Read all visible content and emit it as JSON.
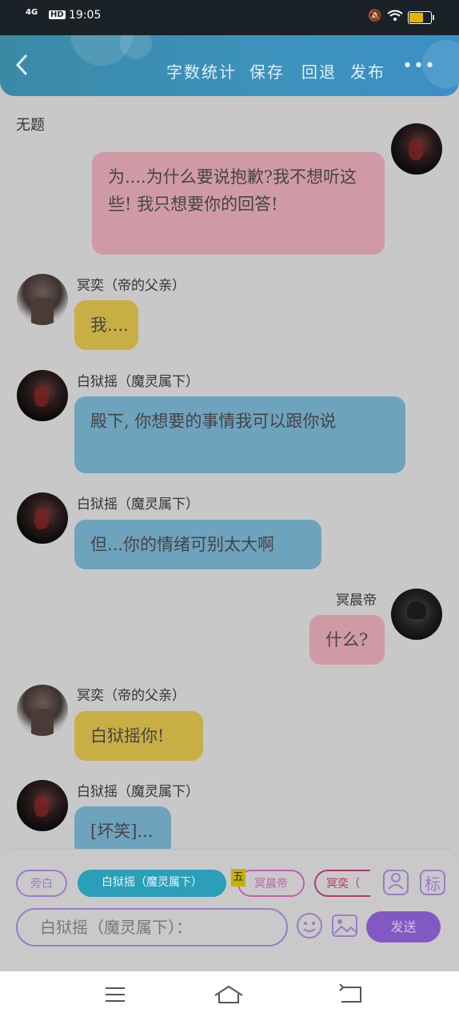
{
  "status_bar": {
    "network": "4G",
    "hd": "HD",
    "time": "19:05",
    "battery_level": 0.7
  },
  "header": {
    "back_icon": "chevron-left-icon",
    "word_count": "字数统计",
    "save": "保存",
    "undo": "回退",
    "publish": "发布",
    "more": "•••"
  },
  "document": {
    "title": "无题"
  },
  "messages": [
    {
      "side": "right",
      "name": "",
      "color": "pink",
      "text": "为....为什么要说抱歉?我不想听这些! 我只想要你的回答!"
    },
    {
      "side": "left",
      "name": "冥奕（帝的父亲）",
      "color": "yellow",
      "text": "我...."
    },
    {
      "side": "left",
      "name": "白狱摇（魔灵属下）",
      "color": "blue",
      "text": "殿下, 你想要的事情我可以跟你说"
    },
    {
      "side": "left",
      "name": "白狱摇（魔灵属下）",
      "color": "blue",
      "text": "但...你的情绪可别太大啊"
    },
    {
      "side": "right",
      "name": "冥晨帝",
      "color": "pink",
      "text": "什么?"
    },
    {
      "side": "left",
      "name": "冥奕（帝的父亲）",
      "color": "yellow",
      "text": "白狱摇你!"
    },
    {
      "side": "left",
      "name": "白狱摇（魔灵属下）",
      "color": "blue",
      "text": "[坏笑]..."
    }
  ],
  "composer": {
    "roles": [
      {
        "label": "旁白"
      },
      {
        "label": "白狱摇（魔灵属下）"
      },
      {
        "label": "冥晨帝"
      },
      {
        "label": "冥奕（"
      }
    ],
    "badge": "五",
    "role_icon": "person-icon",
    "tag_button": "标",
    "input_value": "白狱摇（魔灵属下）：",
    "emoji_icon": "emoji-icon",
    "image_icon": "image-icon",
    "send": "发送"
  },
  "nav": {
    "menu_icon": "menu-icon",
    "home_icon": "home-icon",
    "back_icon": "back-icon"
  }
}
